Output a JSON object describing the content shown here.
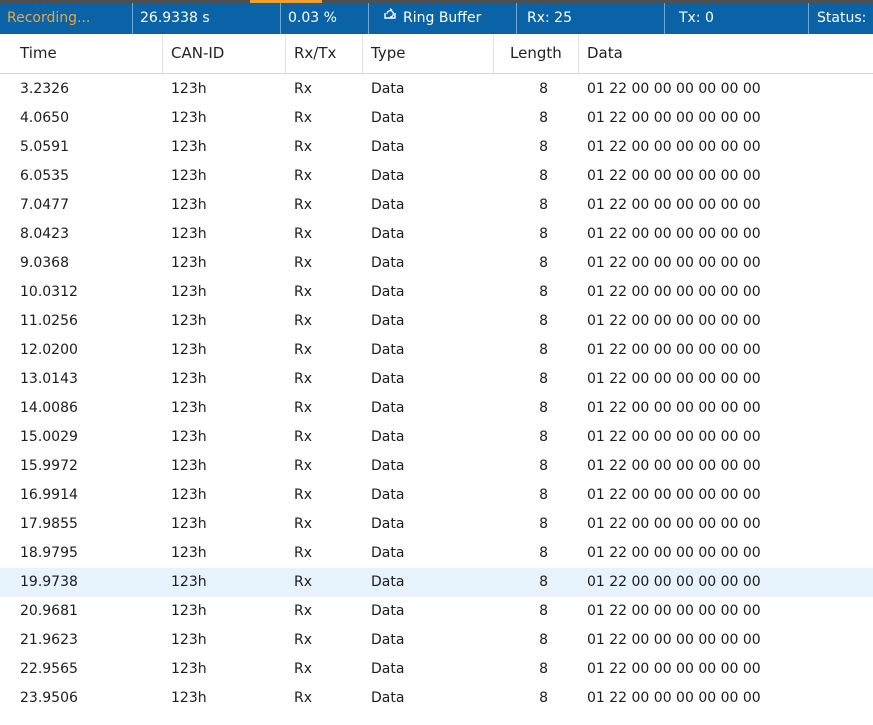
{
  "status_bar": {
    "recording": "Recording...",
    "duration": "26.9338 s",
    "buffer_usage": "0.03 %",
    "ring_buffer_label": "Ring Buffer",
    "ring_buffer_icon": "ring-buffer-icon",
    "rx": "Rx: 25",
    "tx": "Tx: 0",
    "status": "Status:",
    "colors": {
      "background": "#0a63a6",
      "recording_text": "#f2a53a",
      "accent": "#f0a030"
    }
  },
  "table": {
    "columns": [
      "Time",
      "CAN-ID",
      "Rx/Tx",
      "Type",
      "Length",
      "Data"
    ],
    "selected_row_index": 17,
    "rows": [
      [
        "3.2326",
        "123h",
        "Rx",
        "Data",
        "8",
        "01 22 00 00 00 00 00 00"
      ],
      [
        "4.0650",
        "123h",
        "Rx",
        "Data",
        "8",
        "01 22 00 00 00 00 00 00"
      ],
      [
        "5.0591",
        "123h",
        "Rx",
        "Data",
        "8",
        "01 22 00 00 00 00 00 00"
      ],
      [
        "6.0535",
        "123h",
        "Rx",
        "Data",
        "8",
        "01 22 00 00 00 00 00 00"
      ],
      [
        "7.0477",
        "123h",
        "Rx",
        "Data",
        "8",
        "01 22 00 00 00 00 00 00"
      ],
      [
        "8.0423",
        "123h",
        "Rx",
        "Data",
        "8",
        "01 22 00 00 00 00 00 00"
      ],
      [
        "9.0368",
        "123h",
        "Rx",
        "Data",
        "8",
        "01 22 00 00 00 00 00 00"
      ],
      [
        "10.0312",
        "123h",
        "Rx",
        "Data",
        "8",
        "01 22 00 00 00 00 00 00"
      ],
      [
        "11.0256",
        "123h",
        "Rx",
        "Data",
        "8",
        "01 22 00 00 00 00 00 00"
      ],
      [
        "12.0200",
        "123h",
        "Rx",
        "Data",
        "8",
        "01 22 00 00 00 00 00 00"
      ],
      [
        "13.0143",
        "123h",
        "Rx",
        "Data",
        "8",
        "01 22 00 00 00 00 00 00"
      ],
      [
        "14.0086",
        "123h",
        "Rx",
        "Data",
        "8",
        "01 22 00 00 00 00 00 00"
      ],
      [
        "15.0029",
        "123h",
        "Rx",
        "Data",
        "8",
        "01 22 00 00 00 00 00 00"
      ],
      [
        "15.9972",
        "123h",
        "Rx",
        "Data",
        "8",
        "01 22 00 00 00 00 00 00"
      ],
      [
        "16.9914",
        "123h",
        "Rx",
        "Data",
        "8",
        "01 22 00 00 00 00 00 00"
      ],
      [
        "17.9855",
        "123h",
        "Rx",
        "Data",
        "8",
        "01 22 00 00 00 00 00 00"
      ],
      [
        "18.9795",
        "123h",
        "Rx",
        "Data",
        "8",
        "01 22 00 00 00 00 00 00"
      ],
      [
        "19.9738",
        "123h",
        "Rx",
        "Data",
        "8",
        "01 22 00 00 00 00 00 00"
      ],
      [
        "20.9681",
        "123h",
        "Rx",
        "Data",
        "8",
        "01 22 00 00 00 00 00 00"
      ],
      [
        "21.9623",
        "123h",
        "Rx",
        "Data",
        "8",
        "01 22 00 00 00 00 00 00"
      ],
      [
        "22.9565",
        "123h",
        "Rx",
        "Data",
        "8",
        "01 22 00 00 00 00 00 00"
      ],
      [
        "23.9506",
        "123h",
        "Rx",
        "Data",
        "8",
        "01 22 00 00 00 00 00 00"
      ]
    ]
  }
}
